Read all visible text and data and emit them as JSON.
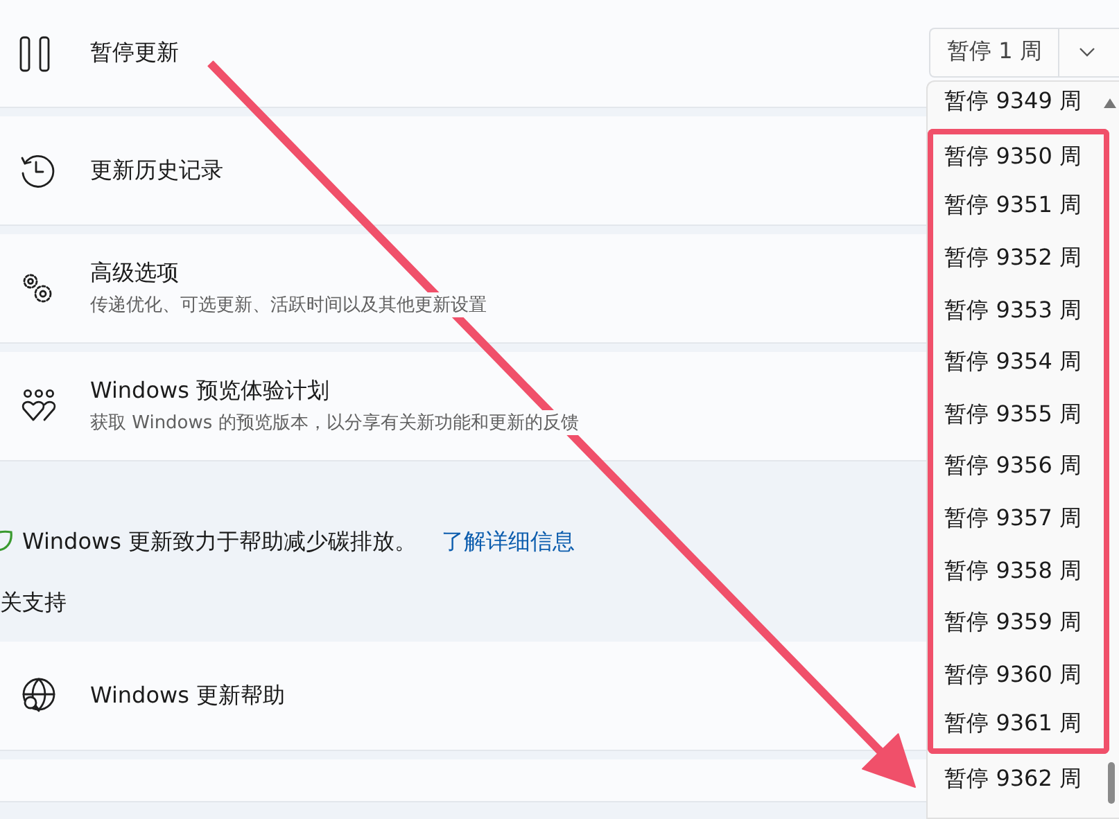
{
  "pause_row": {
    "title": "暂停更新",
    "combo": {
      "value": "暂停 1 周"
    }
  },
  "pause_options": [
    {
      "label": "暂停 9349 周",
      "selected": false,
      "highlighted": false
    },
    {
      "label": "暂停 9350 周",
      "selected": false,
      "highlighted": true
    },
    {
      "label": "暂停 9351 周",
      "selected": false,
      "highlighted": true
    },
    {
      "label": "暂停 9352 周",
      "selected": false,
      "highlighted": true
    },
    {
      "label": "暂停 9353 周",
      "selected": false,
      "highlighted": true
    },
    {
      "label": "暂停 9354 周",
      "selected": false,
      "highlighted": true
    },
    {
      "label": "暂停 9355 周",
      "selected": false,
      "highlighted": true
    },
    {
      "label": "暂停 9356 周",
      "selected": false,
      "highlighted": true
    },
    {
      "label": "暂停 9357 周",
      "selected": false,
      "highlighted": true
    },
    {
      "label": "暂停 9358 周",
      "selected": false,
      "highlighted": true
    },
    {
      "label": "暂停 9359 周",
      "selected": false,
      "highlighted": true
    },
    {
      "label": "暂停 9360 周",
      "selected": false,
      "highlighted": true
    },
    {
      "label": "暂停 9361 周",
      "selected": false,
      "highlighted": true
    },
    {
      "label": "暂停 9362 周",
      "selected": false,
      "highlighted": false
    }
  ],
  "settings": [
    {
      "kind": "history",
      "title": "更新历史记录"
    },
    {
      "kind": "advanced",
      "title": "高级选项",
      "subtitle": "传递优化、可选更新、活跃时间以及其他更新设置"
    },
    {
      "kind": "insider",
      "title": "Windows 预览体验计划",
      "subtitle": "获取 Windows 的预览版本，以分享有关新功能和更新的反馈"
    }
  ],
  "carbon": {
    "text": "Windows 更新致力于帮助减少碳排放。",
    "link": "了解详细信息"
  },
  "support": {
    "heading": "关支持",
    "items": [
      {
        "kind": "help",
        "title": "Windows 更新帮助"
      }
    ]
  }
}
